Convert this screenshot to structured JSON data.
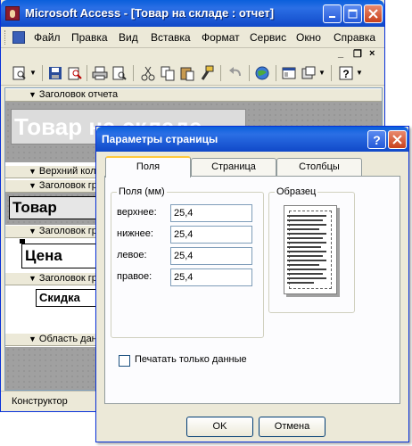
{
  "window": {
    "title": "Microsoft Access - [Товар на складе : отчет]"
  },
  "menu": {
    "items": [
      "Файл",
      "Правка",
      "Вид",
      "Вставка",
      "Формат",
      "Сервис",
      "Окно",
      "Справка"
    ]
  },
  "toolbar": {
    "icons": [
      "view-icon",
      "save-icon",
      "search-icon",
      "print-icon",
      "print-preview-icon",
      "cut-icon",
      "copy-icon",
      "paste-icon",
      "format-painter-icon",
      "undo-icon",
      "web-icon",
      "database-icon",
      "new-object-icon",
      "help-icon"
    ]
  },
  "report": {
    "sections": {
      "report_header": "Заголовок отчета",
      "page_header": "Верхний колонтитул",
      "group_header_1": "Заголовок группы",
      "group_header_2": "Заголовок группы",
      "group_header_3": "Заголовок группы",
      "detail": "Область данных"
    },
    "title_label": "Товар на складе",
    "label_tovar": "Товар",
    "label_cena": "Цена",
    "label_skidka": "Скидка"
  },
  "status": {
    "mode": "Конструктор"
  },
  "dialog": {
    "title": "Параметры страницы",
    "tabs": [
      "Поля",
      "Страница",
      "Столбцы"
    ],
    "margins_group": "Поля (мм)",
    "fields": [
      {
        "label": "верхнее:",
        "value": "25,4"
      },
      {
        "label": "нижнее:",
        "value": "25,4"
      },
      {
        "label": "левое:",
        "value": "25,4"
      },
      {
        "label": "правое:",
        "value": "25,4"
      }
    ],
    "sample_group": "Образец",
    "print_data_only": "Печатать только данные",
    "print_data_only_checked": false,
    "ok": "OK",
    "cancel": "Отмена"
  },
  "colors": {
    "titlebar": "#0a5fdb",
    "face": "#ece9d8",
    "active_tab": "#ffc83c"
  }
}
